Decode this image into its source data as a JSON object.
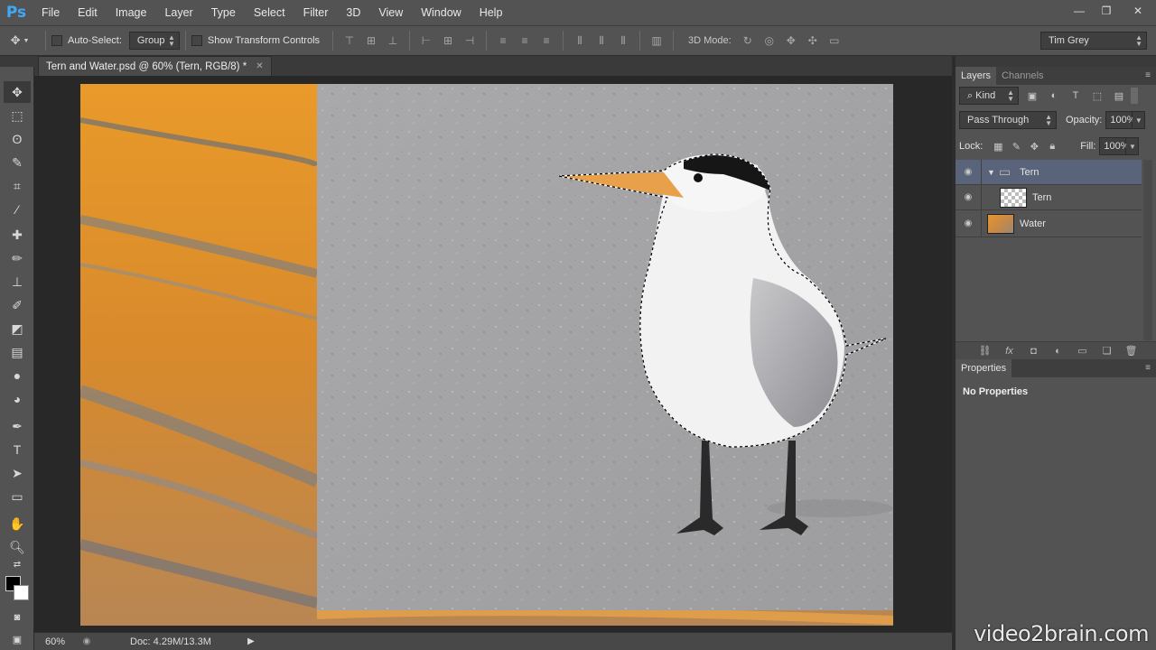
{
  "app": {
    "logo": "Ps"
  },
  "menu": [
    "File",
    "Edit",
    "Image",
    "Layer",
    "Type",
    "Select",
    "Filter",
    "3D",
    "View",
    "Window",
    "Help"
  ],
  "window_controls": {
    "minimize": "—",
    "restore": "❐",
    "close": "✕"
  },
  "options_bar": {
    "auto_select_label": "Auto-Select:",
    "auto_select_value": "Group",
    "show_transform_label": "Show Transform Controls",
    "mode3d_label": "3D Mode:",
    "workspace": "Tim Grey"
  },
  "document": {
    "tab_title": "Tern and Water.psd @ 60% (Tern, RGB/8) *",
    "zoom": "60%",
    "doc_info": "Doc: 4.29M/13.3M"
  },
  "layers_panel": {
    "tabs": [
      "Layers",
      "Channels"
    ],
    "filter_kind": "Kind",
    "blend_mode": "Pass Through",
    "opacity_label": "Opacity:",
    "opacity_value": "100%",
    "lock_label": "Lock:",
    "fill_label": "Fill:",
    "fill_value": "100%",
    "layers": [
      {
        "name": "Tern",
        "type": "group",
        "selected": true
      },
      {
        "name": "Tern",
        "type": "layer",
        "selected": false
      },
      {
        "name": "Water",
        "type": "layer",
        "selected": false
      }
    ]
  },
  "properties_panel": {
    "tab": "Properties",
    "empty_text": "No Properties"
  },
  "watermark": "video2brain.com",
  "colors": {
    "accent": "#3fa9f5",
    "selected_layer": "#59647a",
    "panel_bg": "#535353",
    "canvas_bg": "#282828"
  }
}
